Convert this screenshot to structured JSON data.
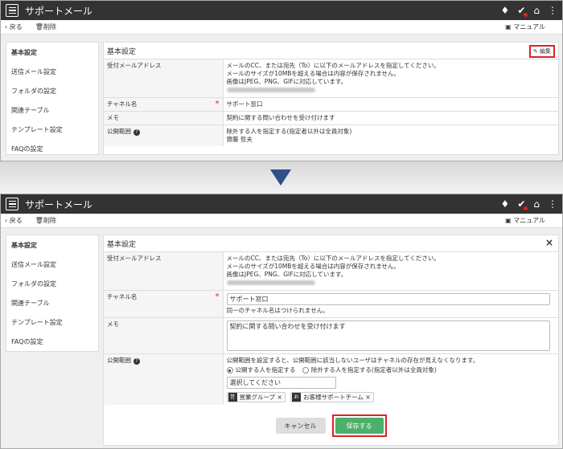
{
  "app": {
    "title": "サポートメール"
  },
  "toolbar": {
    "back": "戻る",
    "delete": "削除",
    "manual": "マニュアル"
  },
  "sidebar": {
    "items": [
      "基本設定",
      "送信メール設定",
      "フォルダの設定",
      "関連テーブル",
      "テンプレート設定",
      "FAQの設定"
    ]
  },
  "panel": {
    "title": "基本設定",
    "edit_label": "編集",
    "close": "×"
  },
  "fields": {
    "address_label": "受付メールアドレス",
    "address_desc": [
      "メールのCC、または宛先（To）に以下のメールアドレスを指定してください。",
      "メールのサイズが10MBを超える場合は内容が保存されません。",
      "画像はJPEG、PNG、GIFに対応しています。"
    ],
    "channel_label": "チャネル名",
    "channel_value": "サポート窓口",
    "channel_note": "同一のチャネル名はつけられません。",
    "memo_label": "メモ",
    "memo_value": "契約に関する問い合わせを受け付けます",
    "scope_label": "公開範囲",
    "scope_view_value": "除外する人を指定する(指定者以外は全員対象)",
    "scope_view_person": "齋藤 哲夫",
    "scope_note": "公開範囲を設定すると、公開範囲に該当しないユーザはチャネルの存在が見えなくなります。",
    "radio_include": "公開する人を指定する",
    "radio_exclude": "除外する人を指定する(指定者以外は全員対象)",
    "select_placeholder": "選択してください",
    "tags": [
      {
        "icon": "営",
        "label": "営業グループ"
      },
      {
        "icon": "お",
        "label": "お客様サポートチーム"
      }
    ]
  },
  "buttons": {
    "cancel": "キャンセル",
    "save": "保存する"
  },
  "colors": {
    "topbar": "#333333",
    "highlight": "#e02020",
    "save": "#4caf6a",
    "arrow": "#2e4f88"
  }
}
